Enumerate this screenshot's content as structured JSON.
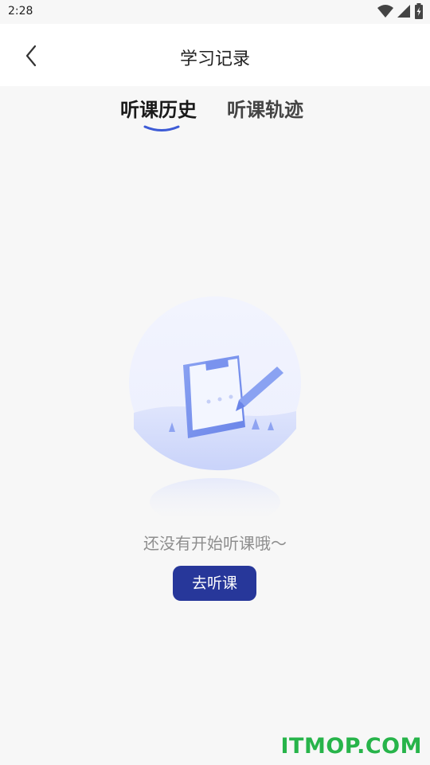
{
  "status_bar": {
    "time": "2:28",
    "icons": [
      "wifi-icon",
      "signal-icon",
      "battery-icon"
    ]
  },
  "header": {
    "title": "学习记录",
    "back_icon": "chevron-left-icon"
  },
  "tabs": [
    {
      "label": "听课历史",
      "active": true
    },
    {
      "label": "听课轨迹",
      "active": false
    }
  ],
  "empty_state": {
    "illustration": "clipboard-pencil-illustration",
    "message": "还没有开始听课哦～",
    "button_label": "去听课"
  },
  "watermark": "ITMOP.COM",
  "colors": {
    "accent": "#27379a",
    "tab_indicator": "#3d5bd6",
    "background": "#f7f7f7",
    "header_bg": "#ffffff",
    "watermark": "#27b44a"
  }
}
